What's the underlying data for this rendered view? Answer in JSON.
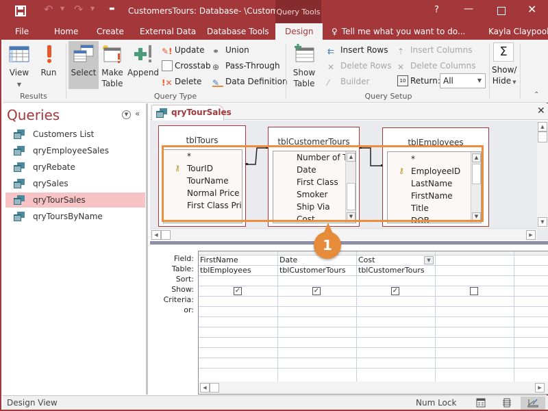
{
  "titlebar": {
    "title": "CustomersTours: Database- \\Custom...",
    "context_tab_header": "Query Tools",
    "help": "?",
    "minimize": "—",
    "close": "✕"
  },
  "tabs": [
    {
      "label": "File"
    },
    {
      "label": "Home"
    },
    {
      "label": "Create"
    },
    {
      "label": "External Data"
    },
    {
      "label": "Database Tools"
    },
    {
      "label": "Design",
      "active": true
    }
  ],
  "tell_me": "Tell me what you want to do...",
  "user": "Kayla Claypool",
  "ribbon": {
    "results": {
      "label": "Results",
      "view": "View",
      "run": "Run"
    },
    "query_type": {
      "label": "Query Type",
      "select": "Select",
      "make_table_1": "Make",
      "make_table_2": "Table",
      "append": "Append",
      "update": "Update",
      "crosstab": "Crosstab",
      "delete": "Delete",
      "union": "Union",
      "pass_through": "Pass-Through",
      "data_definition": "Data Definition"
    },
    "query_setup": {
      "label": "Query Setup",
      "show_table_1": "Show",
      "show_table_2": "Table",
      "insert_rows": "Insert Rows",
      "delete_rows": "Delete Rows",
      "builder": "Builder",
      "insert_columns": "Insert Columns",
      "delete_columns": "Delete Columns",
      "return_label": "Return:",
      "return_value": "All"
    },
    "show_hide_1": "Show/",
    "show_hide_2": "Hide",
    "sigma": "Σ"
  },
  "nav": {
    "title": "Queries",
    "items": [
      {
        "label": "Customers List"
      },
      {
        "label": "qryEmployeeSales"
      },
      {
        "label": "qryRebate"
      },
      {
        "label": "qrySales"
      },
      {
        "label": "qryTourSales",
        "selected": true
      },
      {
        "label": "qryToursByName"
      }
    ]
  },
  "document": {
    "tab_label": "qryTourSales",
    "tables": [
      {
        "name": "tblTours",
        "fields": [
          "*",
          "TourID",
          "TourName",
          "Normal Price",
          "First Class Price"
        ],
        "key": "TourID"
      },
      {
        "name": "tblCustomerTours",
        "fields": [
          "Number of Tic",
          "Date",
          "First Class",
          "Smoker",
          "Ship Via",
          "Cost"
        ]
      },
      {
        "name": "tblEmployees",
        "fields": [
          "*",
          "EmployeeID",
          "LastName",
          "FirstName",
          "Title",
          "DOB"
        ],
        "key": "EmployeeID"
      }
    ],
    "grid": {
      "row_labels": [
        "Field:",
        "Table:",
        "Sort:",
        "Show:",
        "Criteria:",
        "or:"
      ],
      "columns": [
        {
          "field": "FirstName",
          "table": "tblEmployees",
          "show": true
        },
        {
          "field": "Date",
          "table": "tblCustomerTours",
          "show": true
        },
        {
          "field": "Cost",
          "table": "tblCustomerTours",
          "show": true
        },
        {
          "field": "",
          "table": "",
          "show": false
        }
      ]
    }
  },
  "callout": "1",
  "status": {
    "left": "Design View",
    "num_lock": "Num Lock"
  }
}
